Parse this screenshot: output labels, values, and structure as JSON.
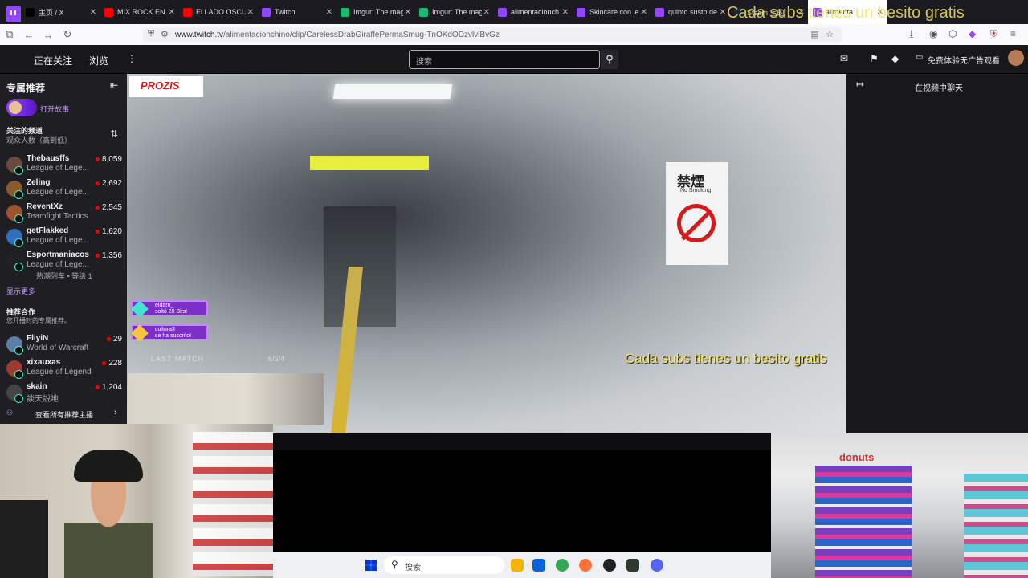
{
  "browser": {
    "tabs": [
      {
        "title": "主页 / X",
        "active": false,
        "color": "#000000"
      },
      {
        "title": "MIX ROCK EN E",
        "active": false,
        "color": "#ff0000"
      },
      {
        "title": "El LADO OSCUR",
        "active": false,
        "color": "#ff0000"
      },
      {
        "title": "Twitch",
        "active": false,
        "color": "#9146ff"
      },
      {
        "title": "Imgur: The mag",
        "active": false,
        "color": "#1bb76e"
      },
      {
        "title": "Imgur: The mag",
        "active": false,
        "color": "#1bb76e"
      },
      {
        "title": "alimentacionch",
        "active": false,
        "color": "#9146ff"
      },
      {
        "title": "Skincare con le",
        "active": false,
        "color": "#9146ff"
      },
      {
        "title": "quinto susto de",
        "active": false,
        "color": "#9146ff"
      },
      {
        "title": "Steam 上的",
        "active": false,
        "color": "#1b2838"
      },
      {
        "title": "alimenta",
        "active": true,
        "color": "#9146ff"
      }
    ],
    "url_prefix": "www.twitch.tv",
    "url_path": "/alimentacionchino/clip/CarelessDrabGiraffePermaSmug-TnOKdODzvlvlBvGz"
  },
  "topnav": {
    "following": "正在关注",
    "browse": "浏览",
    "more": "⋮",
    "search_placeholder": "搜索",
    "ad_free": "免费体验无广告观看"
  },
  "sidebar": {
    "recommended_header": "专属推荐",
    "story_label": "打开故事",
    "followed_header": "关注的频道",
    "followed_sort": "观众人数（高到低）",
    "followed": [
      {
        "name": "Thebausffs",
        "game": "League of Lege...",
        "viewers": "8,059",
        "color": "#6a4a3c"
      },
      {
        "name": "Zeling",
        "game": "League of Lege...",
        "viewers": "2,692",
        "color": "#8b5a2b"
      },
      {
        "name": "ReventXz",
        "game": "Teamfight Tactics",
        "viewers": "2,545",
        "color": "#a0522d"
      },
      {
        "name": "getFlakked",
        "game": "League of Lege...",
        "viewers": "1,620",
        "color": "#2e6fbf"
      },
      {
        "name": "Esportmaniacos",
        "game": "League of Lege...",
        "viewers": "1,356",
        "color": "#222222",
        "extra": "热潮列车 • 等级 1"
      }
    ],
    "show_more": "显示更多",
    "partner_header": "推荐合作",
    "partner_sub": "您开播时的专属推荐。",
    "partners": [
      {
        "name": "FliyiN",
        "game": "World of Warcraft",
        "viewers": "29",
        "color": "#5b7fa6"
      },
      {
        "name": "xixauxas",
        "game": "League of Legends",
        "viewers": "228",
        "color": "#9c3b2f"
      },
      {
        "name": "skain",
        "game": "談天說地",
        "viewers": "1,204",
        "color": "#444444"
      }
    ],
    "view_all": "查看所有推荐主播"
  },
  "video": {
    "sponsor": "PROZIS",
    "alerts": [
      {
        "user": "eldarn_",
        "msg": "soltó 20 Bits!"
      },
      {
        "user": "cultura3",
        "msg": "se ha suscrito!"
      }
    ],
    "last_match": "LAST MATCH",
    "score": "6/5/4",
    "subtitle": "Cada subs tienes un besito gratis",
    "sign_main": "禁煙",
    "sign_sub": "No Smoking",
    "overlay_top": "Cada subs tienes un besito gratis",
    "shop_sign": "donuts"
  },
  "chat": {
    "collapse_icon": "↦",
    "title": "在视频中聊天"
  },
  "taskbar": {
    "search": "搜索"
  }
}
